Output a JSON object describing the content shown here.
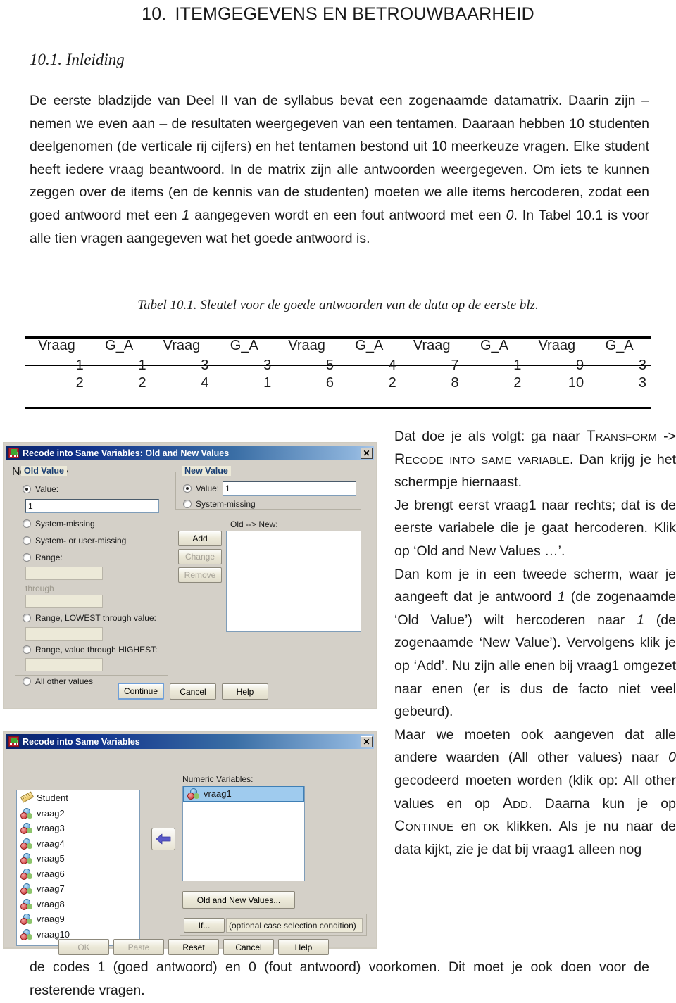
{
  "document": {
    "chapter_number": "10.",
    "chapter_title": "ITEMGEGEVENS EN BETROUWBAARHEID",
    "section_title": "10.1. Inleiding",
    "intro_paragraph": "De eerste bladzijde van Deel II van de syllabus bevat een zogenaamde datamatrix. Daarin zijn – nemen we even aan – de resultaten weergegeven van een tentamen. Daaraan hebben 10 studenten deelgenomen (de verticale rij cijfers) en het tentamen bestond uit 10 meerkeuze vragen. Elke student heeft iedere vraag beantwoord. In de matrix zijn alle antwoorden weergegeven. Om iets te kunnen zeggen over de items (en de kennis van de studenten) moeten we alle items hercoderen, zodat een goed antwoord met een 1 aangegeven wordt en een fout antwoord met een 0. In Tabel 10.1 is voor alle tien vragen aangegeven wat het goede antwoord is.",
    "table_caption": "Tabel 10.1. Sleutel voor de goede antwoorden van de data op de eerste blz.",
    "bottom_paragraph": "de codes 1 (goed antwoord) en 0 (fout antwoord) voorkomen. Dit moet je ook doen voor de resterende vragen."
  },
  "table": {
    "headers": [
      "Vraag",
      "G_A",
      "Vraag",
      "G_A",
      "Vraag",
      "G_A",
      "Vraag",
      "G_A",
      "Vraag",
      "G_A"
    ],
    "rows": [
      [
        "1",
        "1",
        "3",
        "3",
        "5",
        "4",
        "7",
        "1",
        "9",
        "3"
      ],
      [
        "2",
        "2",
        "4",
        "1",
        "6",
        "2",
        "8",
        "2",
        "10",
        "3"
      ]
    ]
  },
  "right_column": {
    "p1_a": "Dat doe je als volgt: ga naar ",
    "p1_sc1": "Transform",
    "p1_b": " -> ",
    "p1_sc2": "Recode into same variable",
    "p1_c": ". Dan krijg je het schermpje hiernaast.",
    "p2_a": "Je brengt eerst vraag1 naar rechts; dat is de eerste variabele die je gaat hercoderen. Klik op ‘Old and New Values …’.",
    "p3_a": "Dan kom je in een tweede scherm, waar je aangeeft dat je antwoord ",
    "p3_i1": "1",
    "p3_b": " (de zogenaamde ‘Old Value’) wilt hercoderen naar ",
    "p3_i2": "1",
    "p3_c": " (de zogenaamde ‘New Value’). Vervolgens klik je op ‘Add’. Nu zijn alle enen bij vraag1 omgezet naar enen (er is dus de facto niet veel gebeurd).",
    "p4_a": "Maar we moeten ook aangeven dat alle andere waarden (All other values) naar ",
    "p4_i1": "0",
    "p4_b": " gecodeerd moeten worden (klik op: All other values en op ",
    "p4_sc1": "Add",
    "p4_c": ". Daarna kun je op ",
    "p4_sc2": "Continue",
    "p4_d": " en ",
    "p4_sc3": "ok",
    "p4_e": " klikken. Als je nu naar de data kijkt, zie je dat bij vraag1 alleen nog"
  },
  "dialog_old_new": {
    "title": "Recode into Same Variables: Old and New Values",
    "close_label": "✕",
    "old_value_group": "Old Value",
    "new_value_group": "New Value",
    "old_radio_value": "Value:",
    "old_value_input": "1",
    "old_radio_system_missing": "System-missing",
    "old_radio_system_user_missing": "System- or user-missing",
    "old_radio_range": "Range:",
    "old_range_from": "",
    "old_range_through_label": "through",
    "old_range_to": "",
    "old_radio_range_lowest": "Range, LOWEST through value:",
    "old_range_lowest_input": "",
    "old_radio_range_highest": "Range, value through HIGHEST:",
    "old_range_highest_input": "",
    "old_radio_all_other": "All other values",
    "new_radio_value": "Value:",
    "new_value_input": "1",
    "new_radio_system_missing": "System-missing",
    "old_new_list_label": "Old --> New:",
    "btn_add": "Add",
    "btn_change": "Change",
    "btn_remove": "Remove",
    "btn_continue": "Continue",
    "btn_cancel": "Cancel",
    "btn_help": "Help"
  },
  "dialog_recode": {
    "title": "Recode into Same Variables",
    "close_label": "✕",
    "source_variables": [
      {
        "name": "Student",
        "icon": "ruler-icon"
      },
      {
        "name": "vraag2",
        "icon": "nominal-icon"
      },
      {
        "name": "vraag3",
        "icon": "nominal-icon"
      },
      {
        "name": "vraag4",
        "icon": "nominal-icon"
      },
      {
        "name": "vraag5",
        "icon": "nominal-icon"
      },
      {
        "name": "vraag6",
        "icon": "nominal-icon"
      },
      {
        "name": "vraag7",
        "icon": "nominal-icon"
      },
      {
        "name": "vraag8",
        "icon": "nominal-icon"
      },
      {
        "name": "vraag9",
        "icon": "nominal-icon"
      },
      {
        "name": "vraag10",
        "icon": "nominal-icon"
      }
    ],
    "numeric_variables_label": "Numeric Variables:",
    "numeric_variables": [
      "vraag1"
    ],
    "btn_old_and_new": "Old and New Values...",
    "btn_if": "If...",
    "if_condition_text": "(optional case selection condition)",
    "btn_ok": "OK",
    "btn_paste": "Paste",
    "btn_reset": "Reset",
    "btn_cancel": "Cancel",
    "btn_help": "Help"
  },
  "colors": {
    "titlebar_start": "#0a246a",
    "titlebar_end": "#a8c6e8",
    "dialog_face": "#ece9d8",
    "group_legend": "#1b3f73",
    "selection": "#9fcbee"
  }
}
